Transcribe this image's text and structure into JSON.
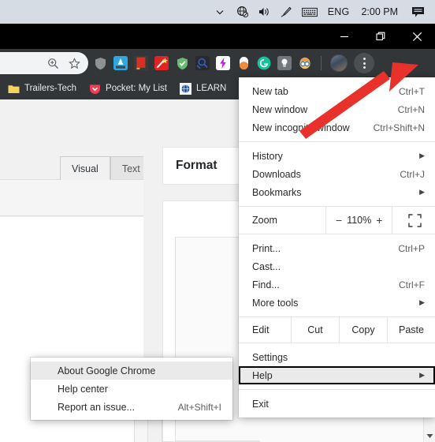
{
  "taskbar": {
    "chevron": "show-hidden-icons",
    "network_icon": "globe-no-internet-icon",
    "volume_icon": "speaker-icon",
    "pen_icon": "pen-icon",
    "keyboard_icon": "touch-keyboard-icon",
    "language": "ENG",
    "clock": "2:00 PM",
    "action_center_icon": "action-center-icon",
    "bg_color": "#d6dce4"
  },
  "window": {
    "minimize_label": "—",
    "maximize_label": "❐",
    "close_label": "✕",
    "titlebar_color": "#000000",
    "toolbar_color": "#323639"
  },
  "toolbar": {
    "zoom_indicator_icon": "page-zoom-icon",
    "bookmark_star_icon": "star-icon",
    "extensions": [
      {
        "name": "shield-extension-icon",
        "color": "#8d9297",
        "glyph": "●"
      },
      {
        "name": "grammar-extension-icon",
        "color": "#2fa8e0",
        "glyph": "A"
      },
      {
        "name": "reading-list-extension-icon",
        "color": "#d93025",
        "glyph": "▮"
      },
      {
        "name": "magic-wand-extension-icon",
        "color": "#e02424",
        "glyph": "✦"
      },
      {
        "name": "adguard-shield-icon",
        "color": "#68bc71",
        "glyph": "✓"
      },
      {
        "name": "search-magnifier-extension-icon",
        "color": "#2b3a67",
        "glyph": "⌕"
      },
      {
        "name": "lightning-extension-icon",
        "color": "#ffffff",
        "glyph": "⚡"
      },
      {
        "name": "capsule-extension-icon",
        "color": "#1b1b1b",
        "glyph": "●"
      },
      {
        "name": "grammarly-extension-icon",
        "color": "#15c39a",
        "glyph": "G"
      },
      {
        "name": "lightbulb-extension-icon",
        "color": "#6f7479",
        "glyph": "Ὂ1"
      },
      {
        "name": "glasses-avatar-extension-icon",
        "color": "#f2b705",
        "glyph": "◉"
      }
    ],
    "profile_avatar": "profile-avatar",
    "menu_icon": "three-dot-menu-icon"
  },
  "bookmarks": [
    {
      "label": "Trailers-Tech",
      "icon": "folder-icon",
      "color": "#f7d774"
    },
    {
      "label": "Pocket: My List",
      "icon": "pocket-icon",
      "color": "#ef3f56"
    },
    {
      "label": "LEARN",
      "icon": "globe-bookmark-icon",
      "color": "#e9ecef"
    }
  ],
  "page": {
    "editor_tabs": [
      {
        "label": "Visual",
        "active": true
      },
      {
        "label": "Text",
        "active": false
      }
    ],
    "format_panel_title": "Format",
    "scrollbar_down_icon": "scroll-down-arrow-icon"
  },
  "chrome_menu": {
    "items": [
      {
        "label": "New tab",
        "accel": "Ctrl+T",
        "submenu": false
      },
      {
        "label": "New window",
        "accel": "Ctrl+N",
        "submenu": false
      },
      {
        "label": "New incognito window",
        "accel": "Ctrl+Shift+N",
        "submenu": false
      }
    ],
    "items2": [
      {
        "label": "History",
        "accel": "",
        "submenu": true
      },
      {
        "label": "Downloads",
        "accel": "Ctrl+J",
        "submenu": false
      },
      {
        "label": "Bookmarks",
        "accel": "",
        "submenu": true
      }
    ],
    "zoom": {
      "label": "Zoom",
      "minus": "−",
      "value": "110%",
      "plus": "+",
      "fullscreen_icon": "fullscreen-icon"
    },
    "items3": [
      {
        "label": "Print...",
        "accel": "Ctrl+P",
        "submenu": false
      },
      {
        "label": "Cast...",
        "accel": "",
        "submenu": false
      },
      {
        "label": "Find...",
        "accel": "Ctrl+F",
        "submenu": false
      },
      {
        "label": "More tools",
        "accel": "",
        "submenu": true
      }
    ],
    "edit_row": {
      "label": "Edit",
      "cut": "Cut",
      "copy": "Copy",
      "paste": "Paste"
    },
    "items4": [
      {
        "label": "Settings",
        "accel": "",
        "submenu": false,
        "highlighted": false
      },
      {
        "label": "Help",
        "accel": "",
        "submenu": true,
        "highlighted": true
      }
    ],
    "items5": [
      {
        "label": "Exit",
        "accel": "",
        "submenu": false
      }
    ],
    "submenu_arrow": "▶"
  },
  "help_submenu": {
    "items": [
      {
        "label": "About Google Chrome",
        "accel": "",
        "selected": true
      },
      {
        "label": "Help center",
        "accel": "",
        "selected": false
      },
      {
        "label": "Report an issue...",
        "accel": "Alt+Shift+I",
        "selected": false
      }
    ]
  },
  "annotation": {
    "arrow_name": "red-pointer-arrow",
    "arrow_color": "#e8312a"
  }
}
